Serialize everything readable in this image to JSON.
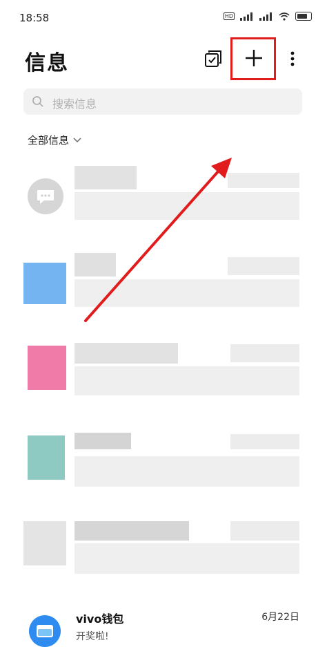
{
  "status": {
    "time": "18:58",
    "battery": "79"
  },
  "header": {
    "title": "信息"
  },
  "search": {
    "placeholder": "搜索信息"
  },
  "filter": {
    "label": "全部信息"
  },
  "conversations": [
    {
      "name": "vivo钱包",
      "preview": "开奖啦!",
      "date": "6月22日"
    }
  ],
  "colors": {
    "highlight": "#e01c1c",
    "annotation_arrow": "#e01c1c",
    "vivo_wallet": "#2e8cf0"
  },
  "icons": [
    "select-edit-icon",
    "add-icon",
    "more-icon",
    "search-icon",
    "chevron-down-icon",
    "chat-bubble-icon",
    "wallet-icon"
  ]
}
